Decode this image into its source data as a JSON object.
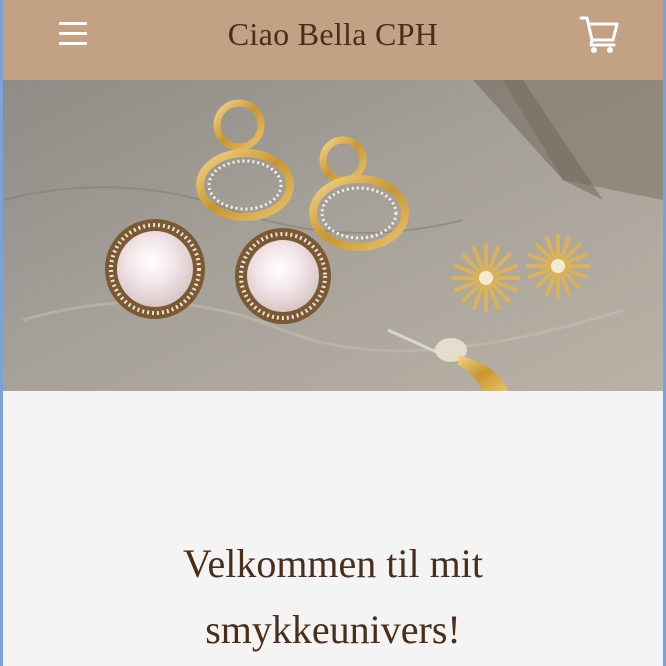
{
  "header": {
    "store_name": "Ciao Bella CPH",
    "menu_icon": "hamburger-menu-icon",
    "cart_icon": "shopping-cart-icon",
    "background_color": "#c2a185",
    "title_color": "#4a2e1a"
  },
  "hero": {
    "image_subject": "earrings-on-stone"
  },
  "main": {
    "welcome_text": "Velkommen til mit smykkeunivers!"
  },
  "colors": {
    "page_background": "#f4f4f4",
    "accent_brown": "#4a2e1a"
  }
}
